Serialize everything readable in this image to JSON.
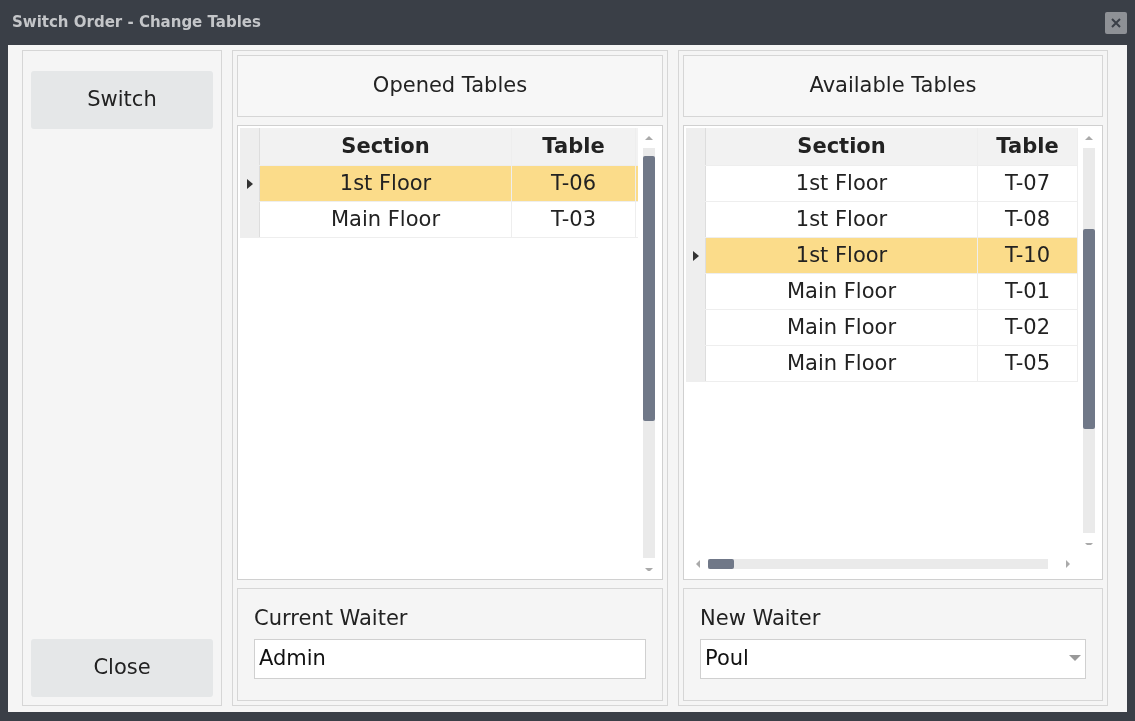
{
  "window": {
    "title": "Switch Order - Change Tables"
  },
  "side_buttons": [
    {
      "label": "Switch"
    },
    {
      "label": "Close"
    }
  ],
  "opened_tables": {
    "title": "Opened Tables",
    "columns": [
      "Section",
      "Table"
    ],
    "rows": [
      {
        "cells": [
          "1st Floor",
          "T-06"
        ],
        "selected": true
      },
      {
        "cells": [
          "Main Floor",
          "T-03"
        ],
        "selected": false
      }
    ]
  },
  "available_tables": {
    "title": "Available Tables",
    "columns": [
      "Section",
      "Table"
    ],
    "rows": [
      {
        "cells": [
          "1st Floor",
          "T-07"
        ],
        "selected": false
      },
      {
        "cells": [
          "1st Floor",
          "T-08"
        ],
        "selected": false
      },
      {
        "cells": [
          "1st Floor",
          "T-10"
        ],
        "selected": true
      },
      {
        "cells": [
          "Main Floor",
          "T-01"
        ],
        "selected": false
      },
      {
        "cells": [
          "Main Floor",
          "T-02"
        ],
        "selected": false
      },
      {
        "cells": [
          "Main Floor",
          "T-05"
        ],
        "selected": false
      }
    ]
  },
  "current_waiter": {
    "label": "Current Waiter",
    "value": "Admin"
  },
  "new_waiter": {
    "label": "New Waiter",
    "value": "Poul"
  }
}
